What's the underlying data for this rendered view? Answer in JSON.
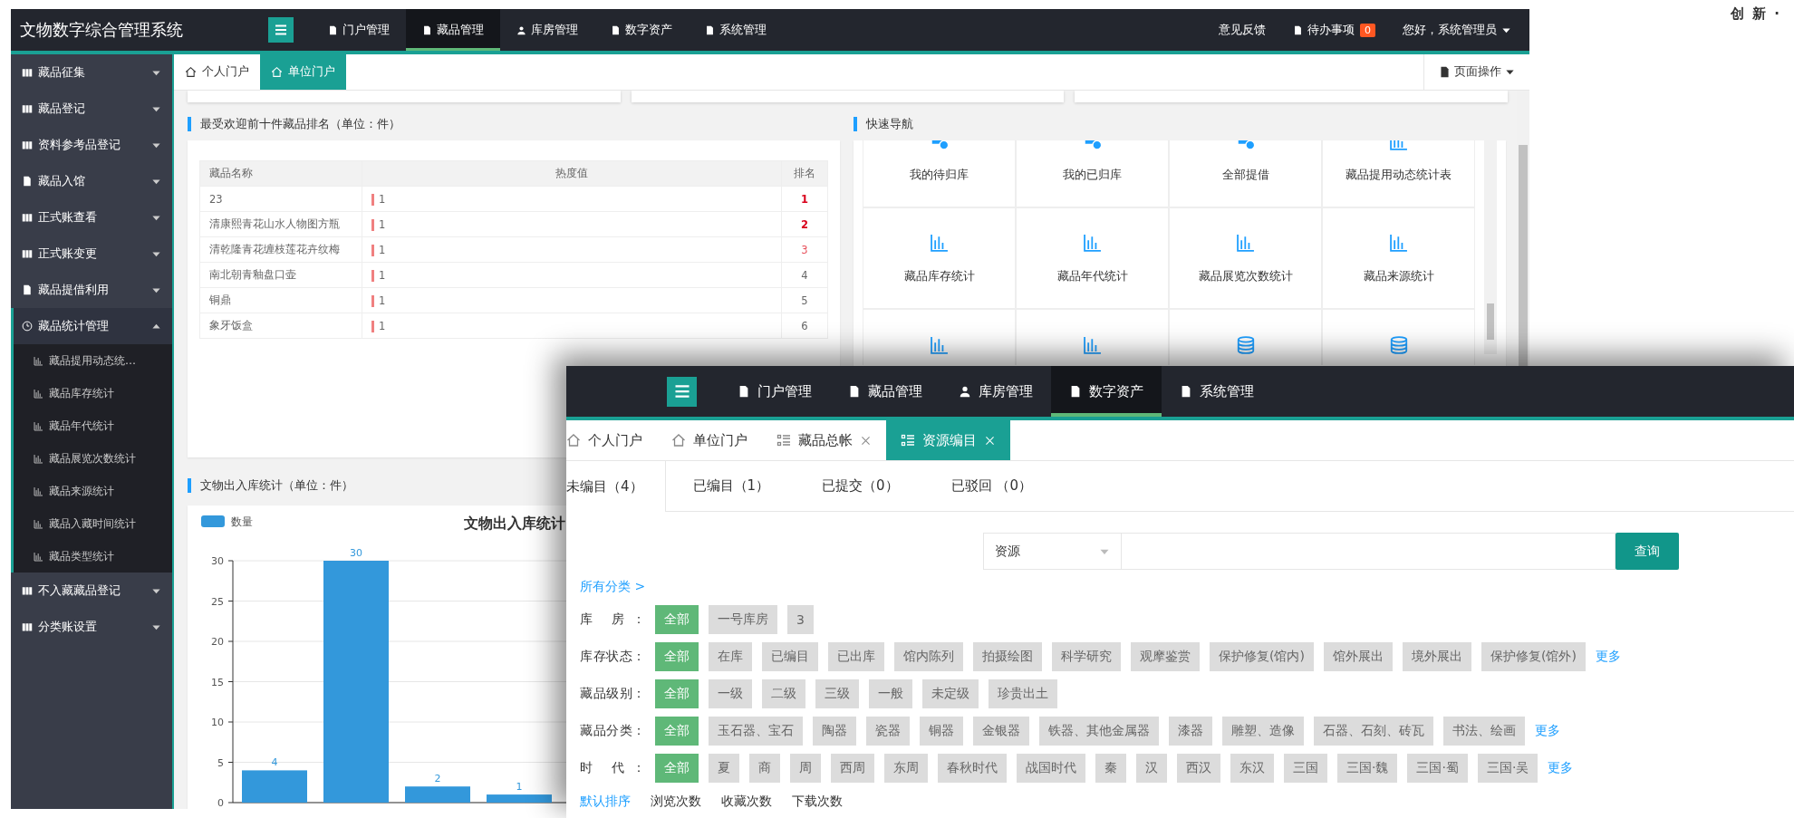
{
  "corner_text": "创 新 ·",
  "main_window": {
    "app_title": "文物数字综合管理系统",
    "nav": [
      {
        "label": "门户管理",
        "kind": "doc",
        "selected": false
      },
      {
        "label": "藏品管理",
        "kind": "doc",
        "selected": true
      },
      {
        "label": "库房管理",
        "kind": "user",
        "selected": false
      },
      {
        "label": "数字资产",
        "kind": "doc",
        "selected": false
      },
      {
        "label": "系统管理",
        "kind": "doc",
        "selected": false
      }
    ],
    "feedback": "意见反馈",
    "todo": {
      "label": "待办事项",
      "count": "0"
    },
    "user_menu": "您好，系统管理员",
    "sidebar": [
      {
        "label": "藏品征集",
        "kind": "books",
        "expanded": false
      },
      {
        "label": "藏品登记",
        "kind": "books",
        "expanded": false
      },
      {
        "label": "资料参考品登记",
        "kind": "books",
        "expanded": false
      },
      {
        "label": "藏品入馆",
        "kind": "doc",
        "expanded": false
      },
      {
        "label": "正式账查看",
        "kind": "books",
        "expanded": false
      },
      {
        "label": "正式账变更",
        "kind": "books",
        "expanded": false
      },
      {
        "label": "藏品提借利用",
        "kind": "doc",
        "expanded": false
      },
      {
        "label": "藏品统计管理",
        "kind": "clock",
        "expanded": true,
        "children": [
          {
            "label": "藏品提用动态统…"
          },
          {
            "label": "藏品库存统计"
          },
          {
            "label": "藏品年代统计"
          },
          {
            "label": "藏品展览次数统计"
          },
          {
            "label": "藏品来源统计"
          },
          {
            "label": "藏品入藏时间统计"
          },
          {
            "label": "藏品类型统计"
          }
        ]
      },
      {
        "label": "不入藏藏品登记",
        "kind": "books",
        "expanded": false
      },
      {
        "label": "分类账设置",
        "kind": "books",
        "expanded": false
      }
    ],
    "tabs": [
      {
        "label": "个人门户",
        "selected": false
      },
      {
        "label": "单位门户",
        "selected": true
      }
    ],
    "page_actions": "页面操作",
    "ranking": {
      "title": "最受欢迎前十件藏品排名（单位：件）",
      "columns": [
        "藏品名称",
        "热度值",
        "排名"
      ],
      "rows": [
        {
          "name": "23",
          "heat": "1",
          "rank": "1",
          "color": "#d9001b"
        },
        {
          "name": "清康熙青花山水人物图方瓶",
          "heat": "1",
          "rank": "2",
          "color": "#d9001b"
        },
        {
          "name": "清乾隆青花缠枝莲花卉纹梅",
          "heat": "1",
          "rank": "3",
          "color": "#e8505b"
        },
        {
          "name": "南北朝青釉盘口壶",
          "heat": "1",
          "rank": "4",
          "color": "#666666"
        },
        {
          "name": "铜鼎",
          "heat": "1",
          "rank": "5",
          "color": "#666666"
        },
        {
          "name": "象牙饭盒",
          "heat": "1",
          "rank": "6",
          "color": "#666666"
        }
      ]
    },
    "quick_nav": {
      "title": "快速导航",
      "items": [
        {
          "label": "我的待归库",
          "kind": "doc-check"
        },
        {
          "label": "我的已归库",
          "kind": "doc-check"
        },
        {
          "label": "全部提借",
          "kind": "doc-check"
        },
        {
          "label": "藏品提用动态统计表",
          "kind": "chart"
        },
        {
          "label": "藏品库存统计",
          "kind": "chart"
        },
        {
          "label": "藏品年代统计",
          "kind": "chart"
        },
        {
          "label": "藏品展览次数统计",
          "kind": "chart"
        },
        {
          "label": "藏品来源统计",
          "kind": "chart"
        },
        {
          "kind": "chart"
        },
        {
          "kind": "chart"
        },
        {
          "kind": "database"
        },
        {
          "kind": "database"
        }
      ]
    },
    "io_chart": {
      "title": "文物出入库统计（单位：件）",
      "chart_data": {
        "type": "bar",
        "title": "文物出入库统计",
        "series": [
          {
            "name": "数量",
            "color": "#3398db",
            "values": [
              4,
              30,
              2,
              1
            ]
          }
        ],
        "ylim": [
          0,
          30
        ],
        "yticks": [
          0,
          5,
          10,
          15,
          20,
          25,
          30
        ],
        "grid": true,
        "data_labels": true
      }
    }
  },
  "second_window": {
    "nav": [
      {
        "label": "门户管理",
        "kind": "doc",
        "selected": false
      },
      {
        "label": "藏品管理",
        "kind": "doc",
        "selected": false
      },
      {
        "label": "库房管理",
        "kind": "user",
        "selected": false
      },
      {
        "label": "数字资产",
        "kind": "doc",
        "selected": true
      },
      {
        "label": "系统管理",
        "kind": "doc",
        "selected": false
      }
    ],
    "tabs": [
      {
        "label": "个人门户",
        "kind": "home",
        "closable": false,
        "selected": false
      },
      {
        "label": "单位门户",
        "kind": "home",
        "closable": false,
        "selected": false
      },
      {
        "label": "藏品总帐",
        "kind": "list",
        "closable": true,
        "selected": false
      },
      {
        "label": "资源编目",
        "kind": "list",
        "closable": true,
        "selected": true
      }
    ],
    "status_tabs": [
      {
        "label": "未编目（4）",
        "selected": true
      },
      {
        "label": "已编目（1）",
        "selected": false
      },
      {
        "label": "已提交（0）",
        "selected": false
      },
      {
        "label": "已驳回 （0）",
        "selected": false
      }
    ],
    "search": {
      "scope": "资源",
      "button": "查询"
    },
    "all_categories": "所有分类 >",
    "filters": [
      {
        "label": "库 房：",
        "options": [
          {
            "label": "全部",
            "selected": true
          },
          {
            "label": "一号库房",
            "selected": false
          },
          {
            "label": "3",
            "selected": false
          }
        ]
      },
      {
        "label": "库存状态：",
        "more": "更多",
        "options": [
          {
            "label": "全部",
            "selected": true
          },
          {
            "label": "在库",
            "selected": false
          },
          {
            "label": "已编目",
            "selected": false
          },
          {
            "label": "已出库",
            "selected": false
          },
          {
            "label": "馆内陈列",
            "selected": false
          },
          {
            "label": "拍摄绘图",
            "selected": false
          },
          {
            "label": "科学研究",
            "selected": false
          },
          {
            "label": "观摩鉴赏",
            "selected": false
          },
          {
            "label": "保护修复(馆内)",
            "selected": false
          },
          {
            "label": "馆外展出",
            "selected": false
          },
          {
            "label": "境外展出",
            "selected": false
          },
          {
            "label": "保护修复(馆外)",
            "selected": false
          }
        ]
      },
      {
        "label": "藏品级别：",
        "options": [
          {
            "label": "全部",
            "selected": true
          },
          {
            "label": "一级",
            "selected": false
          },
          {
            "label": "二级",
            "selected": false
          },
          {
            "label": "三级",
            "selected": false
          },
          {
            "label": "一般",
            "selected": false
          },
          {
            "label": "未定级",
            "selected": false
          },
          {
            "label": "珍贵出土",
            "selected": false
          }
        ]
      },
      {
        "label": "藏品分类：",
        "more": "更多",
        "options": [
          {
            "label": "全部",
            "selected": true
          },
          {
            "label": "玉石器、宝石",
            "selected": false
          },
          {
            "label": "陶器",
            "selected": false
          },
          {
            "label": "瓷器",
            "selected": false
          },
          {
            "label": "铜器",
            "selected": false
          },
          {
            "label": "金银器",
            "selected": false
          },
          {
            "label": "铁器、其他金属器",
            "selected": false
          },
          {
            "label": "漆器",
            "selected": false
          },
          {
            "label": "雕塑、造像",
            "selected": false
          },
          {
            "label": "石器、石刻、砖瓦",
            "selected": false
          },
          {
            "label": "书法、绘画",
            "selected": false
          }
        ]
      },
      {
        "label": "时 代：",
        "more": "更多",
        "options": [
          {
            "label": "全部",
            "selected": true
          },
          {
            "label": "夏",
            "selected": false
          },
          {
            "label": "商",
            "selected": false
          },
          {
            "label": "周",
            "selected": false
          },
          {
            "label": "西周",
            "selected": false
          },
          {
            "label": "东周",
            "selected": false
          },
          {
            "label": "春秋时代",
            "selected": false
          },
          {
            "label": "战国时代",
            "selected": false
          },
          {
            "label": "秦",
            "selected": false
          },
          {
            "label": "汉",
            "selected": false
          },
          {
            "label": "西汉",
            "selected": false
          },
          {
            "label": "东汉",
            "selected": false
          },
          {
            "label": "三国",
            "selected": false
          },
          {
            "label": "三国·魏",
            "selected": false
          },
          {
            "label": "三国·蜀",
            "selected": false
          },
          {
            "label": "三国·吴",
            "selected": false
          }
        ]
      }
    ],
    "sort": [
      {
        "label": "默认排序",
        "selected": true
      },
      {
        "label": "浏览次数",
        "selected": false
      },
      {
        "label": "收藏次数",
        "selected": false
      },
      {
        "label": "下载次数",
        "selected": false
      }
    ]
  }
}
